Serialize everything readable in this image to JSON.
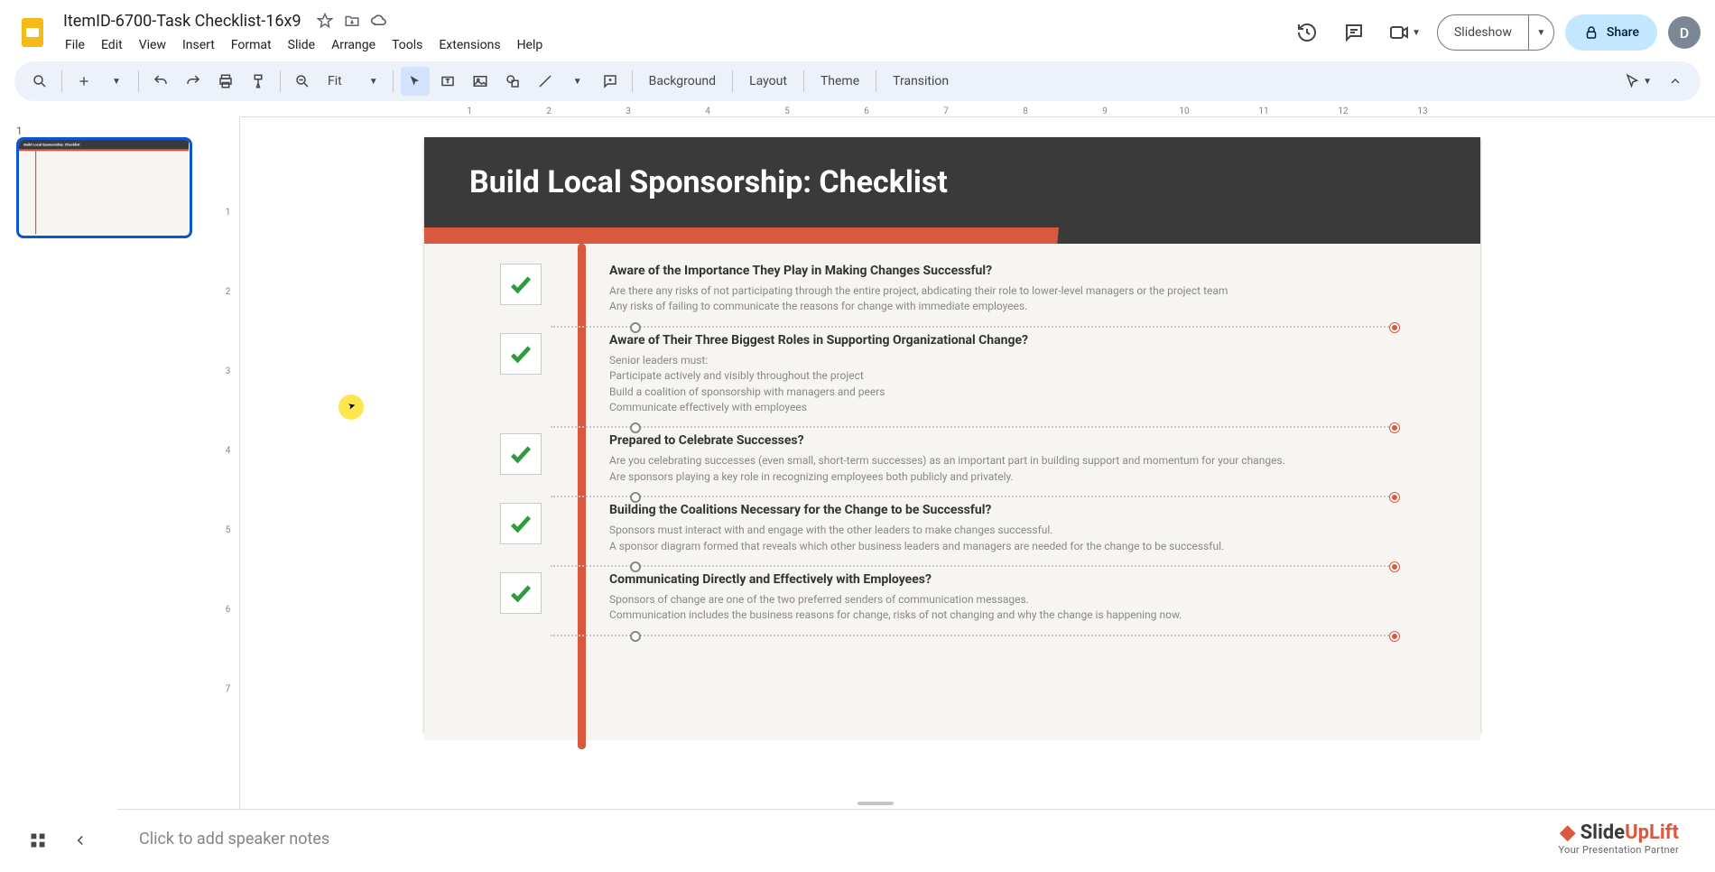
{
  "doc": {
    "title": "ItemID-6700-Task Checklist-16x9"
  },
  "menu": {
    "file": "File",
    "edit": "Edit",
    "view": "View",
    "insert": "Insert",
    "format": "Format",
    "slide": "Slide",
    "arrange": "Arrange",
    "tools": "Tools",
    "extensions": "Extensions",
    "help": "Help"
  },
  "header": {
    "slideshow": "Slideshow",
    "share": "Share",
    "avatar": "D"
  },
  "toolbar": {
    "zoom": "Fit",
    "background": "Background",
    "layout": "Layout",
    "theme": "Theme",
    "transition": "Transition"
  },
  "filmstrip": {
    "slide_number": "1"
  },
  "ruler_h": [
    "1",
    "2",
    "3",
    "4",
    "5",
    "6",
    "7",
    "8",
    "9",
    "10",
    "11",
    "12",
    "13"
  ],
  "ruler_v": [
    "1",
    "2",
    "3",
    "4",
    "5",
    "6",
    "7"
  ],
  "slide": {
    "title": "Build Local Sponsorship: Checklist",
    "items": [
      {
        "title": "Aware of the Importance They Play in Making Changes Successful?",
        "body": "Are there any risks of not participating through the entire project, abdicating their role to lower-level managers or the project team\nAny risks of failing to communicate the reasons for change with immediate employees."
      },
      {
        "title": "Aware of Their Three Biggest Roles in Supporting Organizational Change?",
        "body": "Senior leaders must:\nParticipate actively and visibly throughout the project\nBuild a coalition of sponsorship with managers and peers\nCommunicate effectively with employees"
      },
      {
        "title": "Prepared to Celebrate Successes?",
        "body": "Are you celebrating successes (even small, short-term successes) as an important part in building support and momentum for your changes.\nAre sponsors playing a key role in recognizing employees both publicly and privately."
      },
      {
        "title": "Building the Coalitions Necessary for the Change to be Successful?",
        "body": "Sponsors must interact with and engage with the other leaders to make changes successful.\nA sponsor diagram formed that reveals which other business leaders and managers are needed for the change to be successful."
      },
      {
        "title": "Communicating Directly and Effectively with Employees?",
        "body": "Sponsors of change are one of the two preferred senders of communication messages.\nCommunication includes the business reasons for change, risks of not changing and why the change is happening now."
      }
    ]
  },
  "notes": {
    "placeholder": "Click to add speaker notes"
  },
  "watermark": {
    "brand_a": "Slide",
    "brand_b": "UpLift",
    "tag": "Your Presentation Partner"
  }
}
